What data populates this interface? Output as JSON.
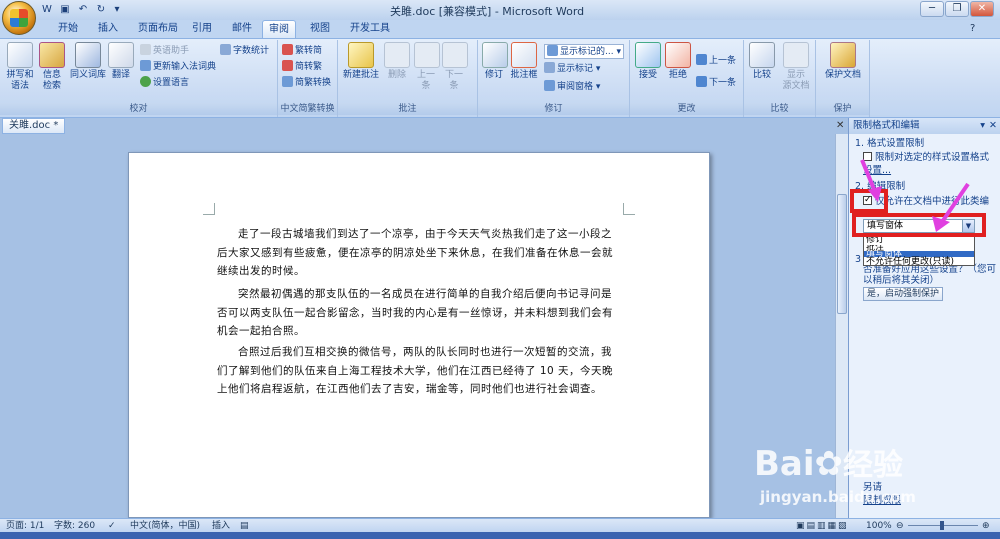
{
  "window": {
    "title": "关雎.doc [兼容模式] - Microsoft Word"
  },
  "tabs": [
    "开始",
    "插入",
    "页面布局",
    "引用",
    "邮件",
    "审阅",
    "视图",
    "开发工具"
  ],
  "active_tab": "审阅",
  "ribbon": {
    "proofing": {
      "label": "校对",
      "spelling": "拼写和\n语法",
      "research": "信息\n检索",
      "thesaurus": "同义词库",
      "translate": "翻译",
      "translate_tip": "英语助手",
      "update_ime": "更新输入法词典",
      "set_language": "设置语言",
      "word_count": "字数统计"
    },
    "chinese": {
      "label": "中文简繁转换",
      "to_trad": "繁转简",
      "to_simp": "简转繁",
      "convert": "简繁转换"
    },
    "comments": {
      "label": "批注",
      "new": "新建批注",
      "delete": "删除",
      "prev": "上一\n条",
      "next": "下一\n条"
    },
    "tracking": {
      "label": "修订",
      "track": "修订",
      "balloons": "批注框",
      "show_markup_sel": "显示标记的...",
      "show_markup": "显示标记",
      "review_pane": "审阅窗格"
    },
    "changes": {
      "label": "更改",
      "accept": "接受",
      "reject": "拒绝",
      "prev": "上一条",
      "next": "下一条"
    },
    "compare": {
      "label": "比较",
      "compare": "比较",
      "show_source": "显示\n源文档"
    },
    "protect": {
      "label": "保护",
      "protect_doc": "保护文档"
    }
  },
  "doc_tab": {
    "name": "关雎.doc *"
  },
  "document": {
    "paragraphs": [
      "走了一段古城墙我们到达了一个凉亭，由于今天天气炎热我们走了这一小段之后大家又感到有些疲惫，便在凉亭的阴凉处坐下来休息，在我们准备在休息一会就继续出发的时候。",
      "突然最初偶遇的那支队伍的一名成员在进行简单的自我介绍后便向书记寻问是否可以两支队伍一起合影留念，当时我的内心是有一丝惊讶，并未料想到我们会有机会一起拍合照。",
      "合照过后我们互相交换的微信号，两队的队长同时也进行一次短暂的交流，我们了解到他们的队伍来自上海工程技术大学，他们在江西已经待了 10 天，今天晚上他们将启程返航，在江西他们去了吉安，瑞金等，同时他们也进行社会调查。"
    ]
  },
  "pane": {
    "title": "限制格式和编辑",
    "s1_heading": "1. 格式设置限制",
    "s1_checkbox": "限制对选定的样式设置格式",
    "s1_link": "设置...",
    "s2_heading": "2. 编辑限制",
    "s2_checkbox": "仅允许在文档中进行此类编",
    "s2_checked": true,
    "select_value": "填写窗体",
    "options": [
      "修订",
      "批注",
      "填写窗体",
      "不允许任何更改(只读)"
    ],
    "selected_option": "填写窗体",
    "s3_text_1": "否准备好应用这些设置？（您可",
    "s3_text_2": "以稍后将其关闭）",
    "start_button": "是，启动强制保护",
    "footer_1": "另请",
    "footer_link": "限制权限"
  },
  "status": {
    "page": "页面: 1/1",
    "words": "字数: 260",
    "lang": "中文(简体，中国)",
    "mode": "插入",
    "zoom": "100%"
  },
  "watermark": {
    "brand": "Bai",
    "brand_cn": "经验",
    "url": "jingyan.baidu.com"
  },
  "colors": {
    "accent": "#15428b",
    "highlight": "#e02020",
    "arrow": "#e040e0",
    "selection": "#316ac5"
  }
}
